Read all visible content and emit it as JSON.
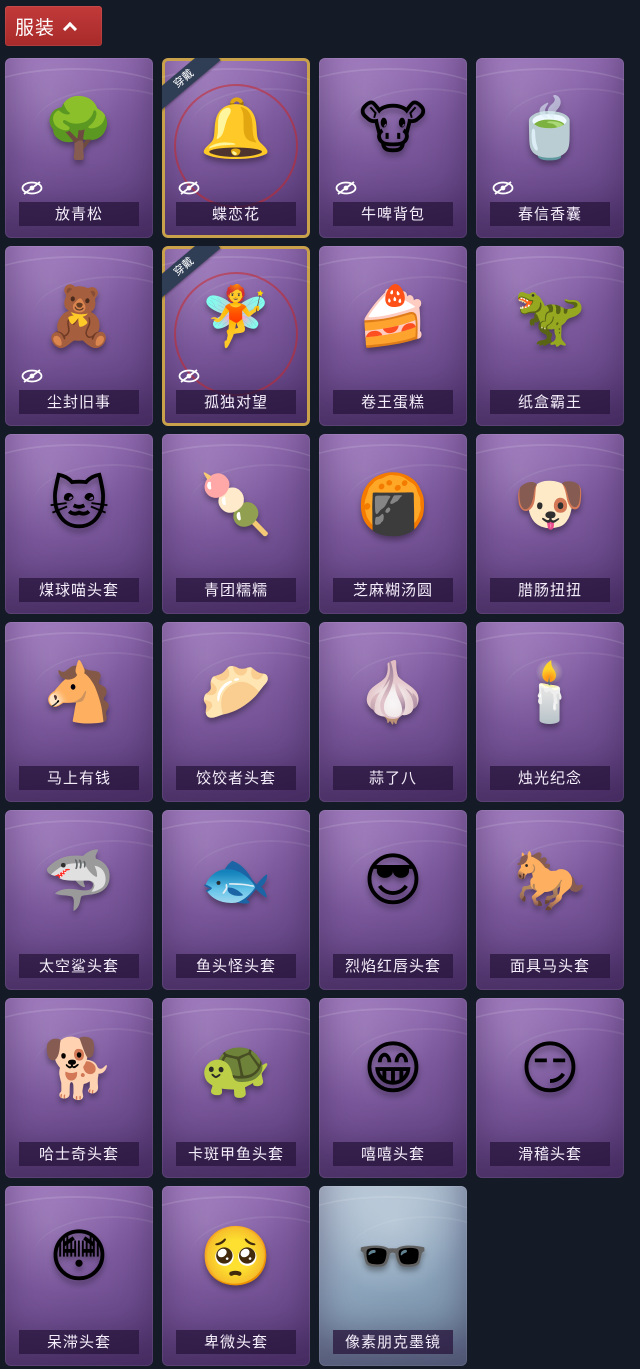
{
  "header": {
    "title": "服装",
    "chevron_icon": "chevron-up-icon"
  },
  "badge_label": "穿戴",
  "items": [
    {
      "name": "放青松",
      "icon": "🌳",
      "hidden": true,
      "equipped": false,
      "style": "purple"
    },
    {
      "name": "蝶恋花",
      "icon": "🔔",
      "hidden": true,
      "equipped": true,
      "style": "purple"
    },
    {
      "name": "牛啤背包",
      "icon": "🐮",
      "hidden": true,
      "equipped": false,
      "style": "purple"
    },
    {
      "name": "春信香囊",
      "icon": "🍵",
      "hidden": true,
      "equipped": false,
      "style": "purple"
    },
    {
      "name": "尘封旧事",
      "icon": "🧸",
      "hidden": true,
      "equipped": false,
      "style": "purple"
    },
    {
      "name": "孤独对望",
      "icon": "🧚",
      "hidden": true,
      "equipped": true,
      "style": "purple"
    },
    {
      "name": "卷王蛋糕",
      "icon": "🍰",
      "hidden": false,
      "equipped": false,
      "style": "purple"
    },
    {
      "name": "纸盒霸王",
      "icon": "🦖",
      "hidden": false,
      "equipped": false,
      "style": "purple"
    },
    {
      "name": "煤球喵头套",
      "icon": "🐱",
      "hidden": false,
      "equipped": false,
      "style": "purple"
    },
    {
      "name": "青团糯糯",
      "icon": "🍡",
      "hidden": false,
      "equipped": false,
      "style": "purple"
    },
    {
      "name": "芝麻糊汤圆",
      "icon": "🍘",
      "hidden": false,
      "equipped": false,
      "style": "purple"
    },
    {
      "name": "腊肠扭扭",
      "icon": "🐶",
      "hidden": false,
      "equipped": false,
      "style": "purple"
    },
    {
      "name": "马上有钱",
      "icon": "🐴",
      "hidden": false,
      "equipped": false,
      "style": "purple"
    },
    {
      "name": "饺饺者头套",
      "icon": "🥟",
      "hidden": false,
      "equipped": false,
      "style": "purple"
    },
    {
      "name": "蒜了八",
      "icon": "🧄",
      "hidden": false,
      "equipped": false,
      "style": "purple"
    },
    {
      "name": "烛光纪念",
      "icon": "🕯️",
      "hidden": false,
      "equipped": false,
      "style": "purple"
    },
    {
      "name": "太空鲨头套",
      "icon": "🦈",
      "hidden": false,
      "equipped": false,
      "style": "purple"
    },
    {
      "name": "鱼头怪头套",
      "icon": "🐟",
      "hidden": false,
      "equipped": false,
      "style": "purple"
    },
    {
      "name": "烈焰红唇头套",
      "icon": "😎",
      "hidden": false,
      "equipped": false,
      "style": "purple"
    },
    {
      "name": "面具马头套",
      "icon": "🐎",
      "hidden": false,
      "equipped": false,
      "style": "purple"
    },
    {
      "name": "哈士奇头套",
      "icon": "🐕",
      "hidden": false,
      "equipped": false,
      "style": "purple"
    },
    {
      "name": "卡斑甲鱼头套",
      "icon": "🐢",
      "hidden": false,
      "equipped": false,
      "style": "purple"
    },
    {
      "name": "嘻嘻头套",
      "icon": "😁",
      "hidden": false,
      "equipped": false,
      "style": "purple"
    },
    {
      "name": "滑稽头套",
      "icon": "😏",
      "hidden": false,
      "equipped": false,
      "style": "purple"
    },
    {
      "name": "呆滞头套",
      "icon": "😳",
      "hidden": false,
      "equipped": false,
      "style": "purple"
    },
    {
      "name": "卑微头套",
      "icon": "🥺",
      "hidden": false,
      "equipped": false,
      "style": "purple"
    },
    {
      "name": "像素朋克墨镜",
      "icon": "🕶️",
      "hidden": false,
      "equipped": false,
      "style": "blue"
    }
  ]
}
